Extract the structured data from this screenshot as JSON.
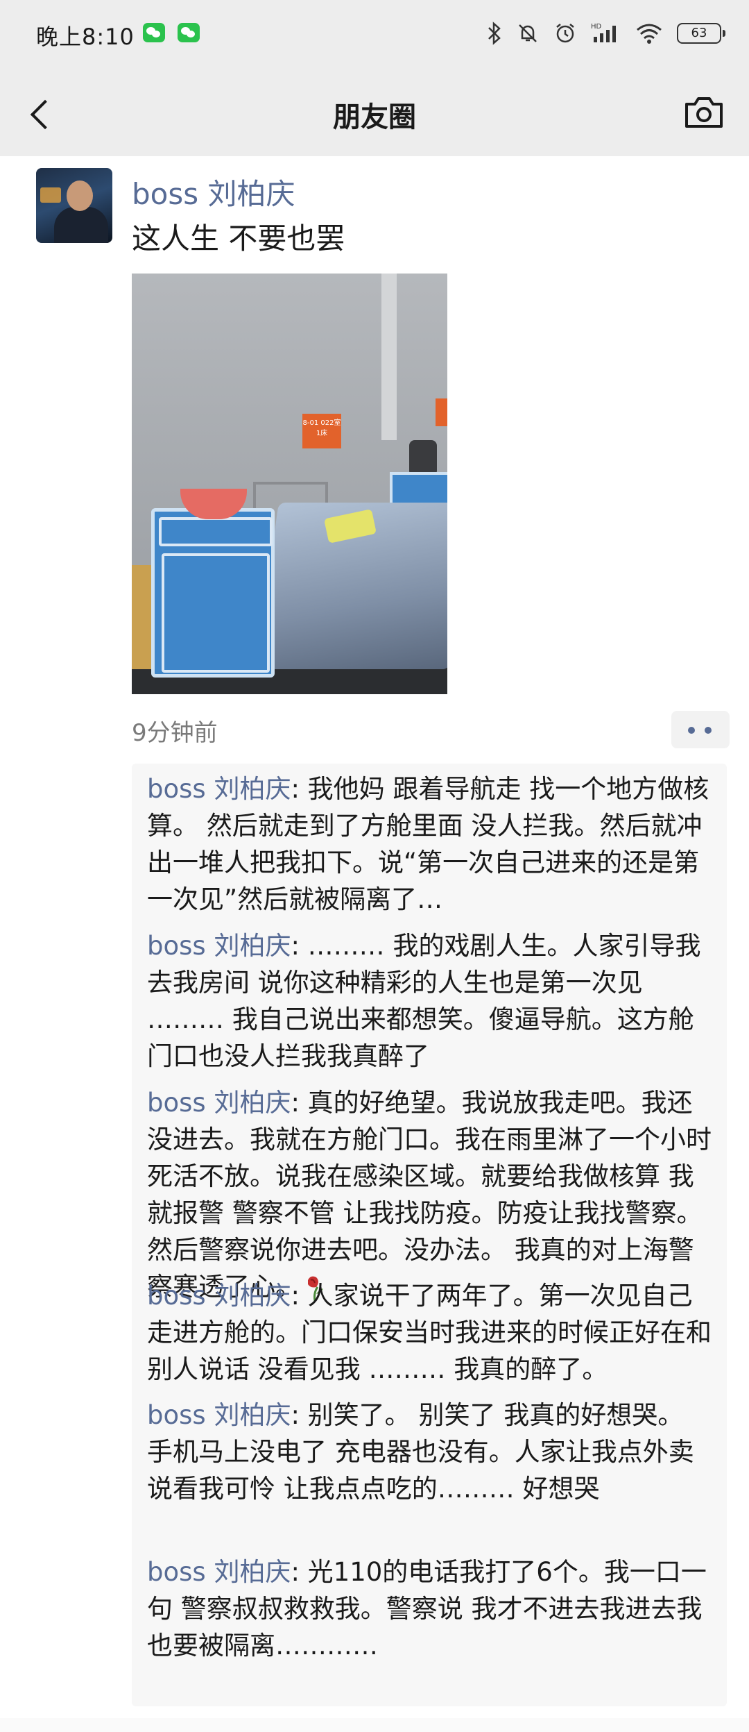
{
  "status_bar": {
    "time": "晚上8:10",
    "battery": "63"
  },
  "nav": {
    "title": "朋友圈"
  },
  "post": {
    "username": "boss 刘柏庆",
    "text": "这人生 不要也罢",
    "photo_sign": "8-01 022室1床",
    "time_ago": "9分钟前"
  },
  "comments": [
    {
      "author": "boss 刘柏庆",
      "text": ": 我他妈 跟着导航走 找一个地方做核算。 然后就走到了方舱里面 没人拦我。然后就冲出一堆人把我扣下。说“第一次自己进来的还是第一次见”然后就被隔离了…"
    },
    {
      "author": "boss 刘柏庆",
      "text": ": ……… 我的戏剧人生。人家引导我去我房间 说你这种精彩的人生也是第一次见 ……… 我自己说出来都想笑。傻逼导航。这方舱门口也没人拦我我真醉了"
    },
    {
      "author": "boss 刘柏庆",
      "text": ": 真的好绝望。我说放我走吧。我还没进去。我就在方舱门口。我在雨里淋了一个小时 死活不放。说我在感染区域。就要给我做核算 我就报警 警察不管 让我找防疫。防疫让我找警察。然后警察说你进去吧。没办法。 我真的对上海警察寒透了心。"
    },
    {
      "author": "boss 刘柏庆",
      "text": ": 人家说干了两年了。第一次见自己走进方舱的。门口保安当时我进来的时候正好在和别人说话 没看见我 ……… 我真的醉了。"
    },
    {
      "author": "boss 刘柏庆",
      "text": ": 别笑了。 别笑了 我真的好想哭。 手机马上没电了 充电器也没有。人家让我点外卖 说看我可怜 让我点点吃的……… 好想哭"
    },
    {
      "author": "boss 刘柏庆",
      "text": ": 光110的电话我打了6个。我一口一句 警察叔叔救救我。警察说 我才不进去我进去我也要被隔离…………"
    }
  ],
  "icons": {
    "back": "back-arrow-icon",
    "camera": "camera-icon",
    "more": "more-dots-icon",
    "wilted_rose": "wilted-rose-emoji"
  },
  "colors": {
    "link_name": "#576b95",
    "header_bg": "#ededed",
    "comment_bg": "#f7f7f7"
  }
}
